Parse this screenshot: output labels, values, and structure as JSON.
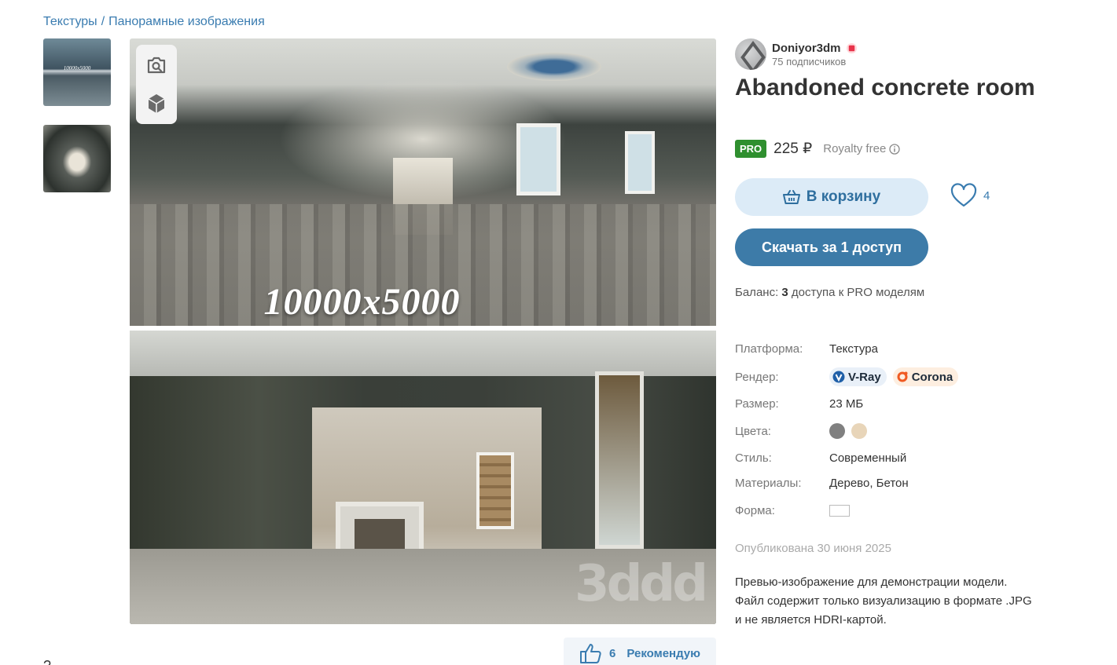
{
  "breadcrumb": {
    "items": [
      "Текстуры",
      "Панорамные изображения"
    ],
    "separator": "/"
  },
  "gallery": {
    "thumb1_label": "10000x5000",
    "watermark_text": "10000x5000",
    "logo_watermark": "3ddd"
  },
  "author": {
    "name": "Doniyor3dm",
    "subscribers": "75 подписчиков"
  },
  "product": {
    "title": "Abandoned concrete room",
    "pro_label": "PRO",
    "price": "225 ₽",
    "license": "Royalty free"
  },
  "actions": {
    "cart_label": "В корзину",
    "like_count": "4",
    "download_label": "Скачать за 1 доступ",
    "recommend_count": "6",
    "recommend_label": "Рекомендую"
  },
  "balance": {
    "prefix": "Баланс:",
    "count": "3",
    "suffix": "доступа к PRO моделям"
  },
  "specs": {
    "platform_label": "Платформа:",
    "platform_value": "Текстура",
    "render_label": "Рендер:",
    "render_values": [
      "V-Ray",
      "Corona"
    ],
    "size_label": "Размер:",
    "size_value": "23 МБ",
    "colors_label": "Цвета:",
    "colors": [
      "#808080",
      "#e8d5b9"
    ],
    "style_label": "Стиль:",
    "style_value": "Современный",
    "materials_label": "Материалы:",
    "materials_value": "Дерево, Бетон",
    "shape_label": "Форма:"
  },
  "published": "Опубликована 30 июня 2025",
  "description": [
    "Превью-изображение для демонстрации модели.",
    "Файл содержит только визуализацию в формате .JPG",
    "и не является HDRI-картой."
  ],
  "bottom_cut_text": "?"
}
